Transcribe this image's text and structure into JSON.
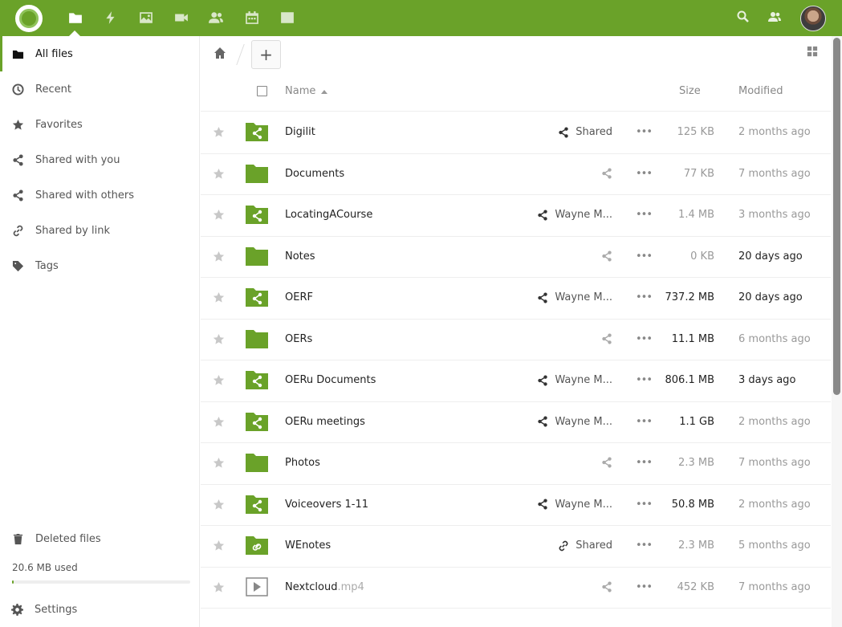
{
  "header": {
    "apps": [
      "files-icon",
      "activity-icon",
      "gallery-icon",
      "video-icon",
      "contacts-icon",
      "calendar-icon",
      "notes-icon"
    ],
    "right_icons": [
      "search-icon",
      "contacts-menu-icon",
      "avatar"
    ],
    "accent_color": "#6aa229"
  },
  "sidebar": {
    "items": [
      {
        "label": "All files",
        "icon": "folder-icon",
        "active": true
      },
      {
        "label": "Recent",
        "icon": "clock-icon"
      },
      {
        "label": "Favorites",
        "icon": "star-icon"
      },
      {
        "label": "Shared with you",
        "icon": "share-icon"
      },
      {
        "label": "Shared with others",
        "icon": "share-icon"
      },
      {
        "label": "Shared by link",
        "icon": "link-icon"
      },
      {
        "label": "Tags",
        "icon": "tag-icon"
      }
    ],
    "deleted_label": "Deleted files",
    "quota_text": "20.6 MB used",
    "quota_fraction": 0.01,
    "settings_label": "Settings"
  },
  "main": {
    "add_label": "+",
    "columns": {
      "name": "Name",
      "size": "Size",
      "modified": "Modified"
    },
    "files": [
      {
        "name": "Digilit",
        "ext": "",
        "type": "shared-folder",
        "share": "Shared",
        "share_kind": "active",
        "size": "125 KB",
        "size_dark": false,
        "modified": "2 months ago",
        "mod_dark": false
      },
      {
        "name": "Documents",
        "ext": "",
        "type": "folder",
        "share": "",
        "share_kind": "dim",
        "size": "77 KB",
        "size_dark": false,
        "modified": "7 months ago",
        "mod_dark": false
      },
      {
        "name": "LocatingACourse",
        "ext": "",
        "type": "shared-folder",
        "share": "Wayne M...",
        "share_kind": "active",
        "size": "1.4 MB",
        "size_dark": false,
        "modified": "3 months ago",
        "mod_dark": false
      },
      {
        "name": "Notes",
        "ext": "",
        "type": "folder",
        "share": "",
        "share_kind": "dim",
        "size": "0 KB",
        "size_dark": false,
        "modified": "20 days ago",
        "mod_dark": true
      },
      {
        "name": "OERF",
        "ext": "",
        "type": "shared-folder",
        "share": "Wayne M...",
        "share_kind": "active",
        "size": "737.2 MB",
        "size_dark": true,
        "modified": "20 days ago",
        "mod_dark": true
      },
      {
        "name": "OERs",
        "ext": "",
        "type": "folder",
        "share": "",
        "share_kind": "dim",
        "size": "11.1 MB",
        "size_dark": true,
        "modified": "6 months ago",
        "mod_dark": false
      },
      {
        "name": "OERu Documents",
        "ext": "",
        "type": "shared-folder",
        "share": "Wayne M...",
        "share_kind": "active",
        "size": "806.1 MB",
        "size_dark": true,
        "modified": "3 days ago",
        "mod_dark": true
      },
      {
        "name": "OERu meetings",
        "ext": "",
        "type": "shared-folder",
        "share": "Wayne M...",
        "share_kind": "active",
        "size": "1.1 GB",
        "size_dark": true,
        "modified": "2 months ago",
        "mod_dark": false
      },
      {
        "name": "Photos",
        "ext": "",
        "type": "folder",
        "share": "",
        "share_kind": "dim",
        "size": "2.3 MB",
        "size_dark": false,
        "modified": "7 months ago",
        "mod_dark": false
      },
      {
        "name": "Voiceovers 1-11",
        "ext": "",
        "type": "shared-folder",
        "share": "Wayne M...",
        "share_kind": "active",
        "size": "50.8 MB",
        "size_dark": true,
        "modified": "2 months ago",
        "mod_dark": false
      },
      {
        "name": "WEnotes",
        "ext": "",
        "type": "link-folder",
        "share": "Shared",
        "share_kind": "link",
        "size": "2.3 MB",
        "size_dark": false,
        "modified": "5 months ago",
        "mod_dark": false
      },
      {
        "name": "Nextcloud",
        "ext": ".mp4",
        "type": "video",
        "share": "",
        "share_kind": "dim",
        "size": "452 KB",
        "size_dark": false,
        "modified": "7 months ago",
        "mod_dark": false
      }
    ]
  }
}
